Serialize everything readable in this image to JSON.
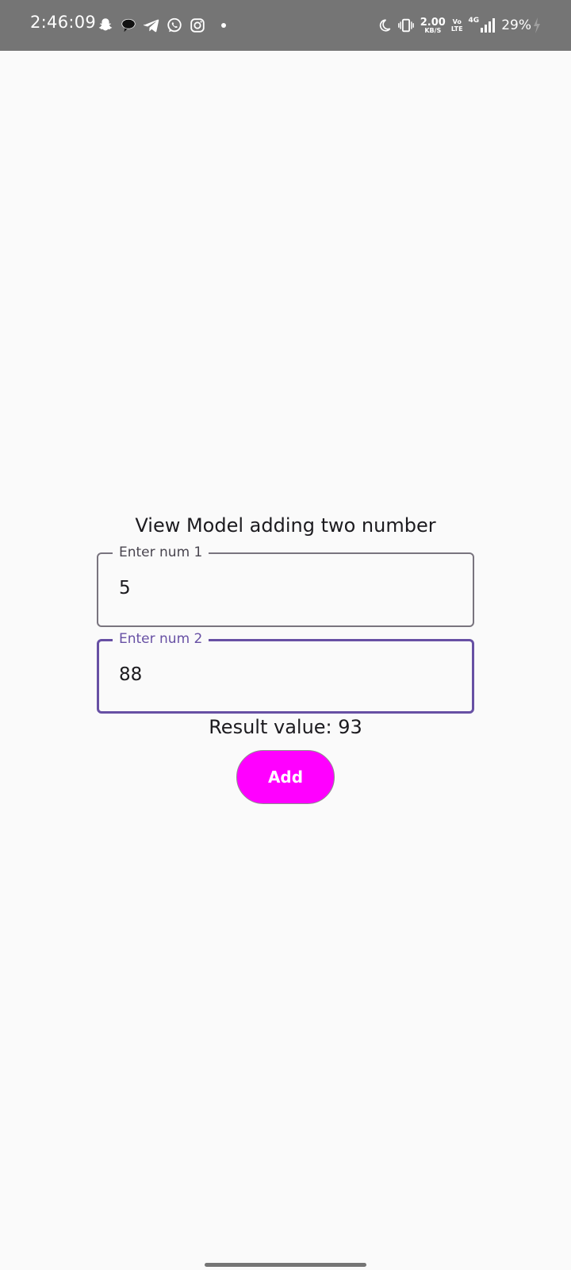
{
  "status_bar": {
    "time": "2:46:09",
    "notification_icons": [
      "snapchat-icon",
      "chat-bubble-icon",
      "telegram-icon",
      "whatsapp-icon",
      "instagram-icon"
    ],
    "net_speed_value": "2.00",
    "net_speed_unit": "KB/S",
    "volte_top": "Vo",
    "volte_bottom": "LTE",
    "network_type": "4G",
    "battery_percent": "29%"
  },
  "main": {
    "title": "View Model adding two number",
    "num1": {
      "label": "Enter num 1",
      "value": "5"
    },
    "num2": {
      "label": "Enter num 2",
      "value": "88"
    },
    "result_text": "Result value: 93",
    "add_label": "Add"
  },
  "colors": {
    "accent": "#6750a4",
    "button": "#ff00ff",
    "status_bar": "#757575",
    "background": "#fafafa"
  }
}
